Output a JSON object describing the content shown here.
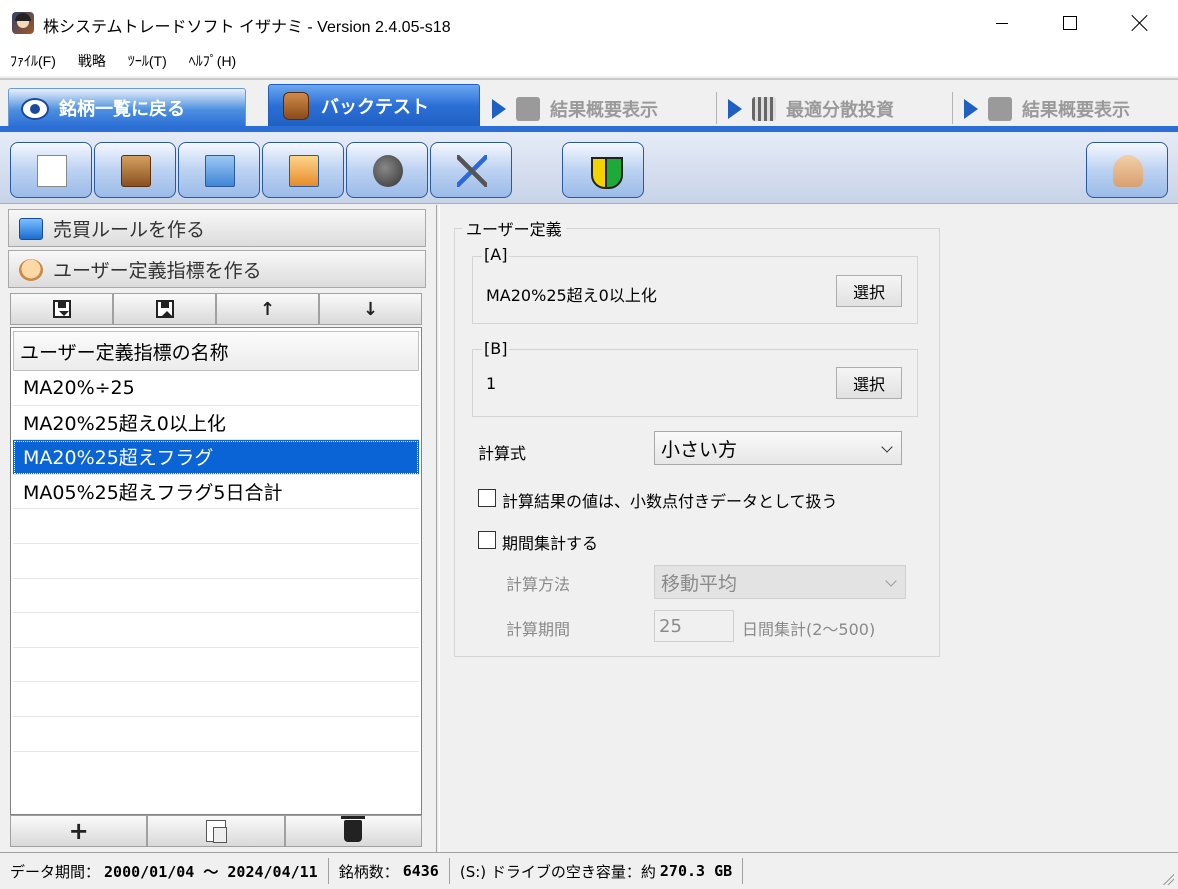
{
  "window": {
    "title": "株システムトレードソフト イザナミ - Version 2.4.05-s18"
  },
  "menu": {
    "items": [
      "ﾌｧｲﾙ(F)",
      "戦略",
      "ﾂｰﾙ(T)",
      "ﾍﾙﾌﾟ(H)"
    ]
  },
  "mode_tabs": {
    "back_label": "銘柄一覧に戻る",
    "active_label": "バックテスト",
    "disabled": [
      "結果概要表示",
      "最適分散投資",
      "結果概要表示"
    ],
    "active_color": "#2b6fd6"
  },
  "left_panel": {
    "button_rules": "売買ルールを作る",
    "button_user_indicator": "ユーザー定義指標を作る",
    "list_header": "ユーザー定義指標の名称",
    "list_items": [
      "MA20%÷25",
      "MA20%25超え0以上化",
      "MA20%25超えフラグ",
      "MA05%25超えフラグ5日合計",
      "",
      "",
      "",
      "",
      "",
      "",
      ""
    ],
    "selected_index": 2,
    "add_symbol": "+"
  },
  "right_panel": {
    "group_title": "ユーザー定義",
    "a": {
      "title": "[A]",
      "value": "MA20%25超え0以上化",
      "select_label": "選択"
    },
    "b": {
      "title": "[B]",
      "value": "1",
      "select_label": "選択"
    },
    "formula_label": "計算式",
    "formula_value": "小さい方",
    "decimal_checkbox_label": "計算結果の値は、小数点付きデータとして扱う",
    "period_checkbox_label": "期間集計する",
    "method_label": "計算方法",
    "method_value": "移動平均",
    "period_label": "計算期間",
    "period_value": "25",
    "period_suffix": "日間集計(2～500)"
  },
  "status": {
    "data_period_label": "データ期間：",
    "data_period_value": "2000/01/04 ～ 2024/04/11",
    "stocks_label": "銘柄数：",
    "stocks_value": "6436",
    "drive_label": "(S:) ドライブの空き容量：約",
    "drive_value": "270.3 GB"
  }
}
